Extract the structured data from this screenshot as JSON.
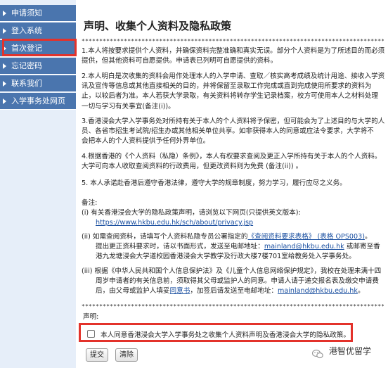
{
  "sidebar": {
    "items": [
      {
        "label": "申请须知"
      },
      {
        "label": "登入系统"
      },
      {
        "label": "首次登记"
      },
      {
        "label": "忘记密码"
      },
      {
        "label": "联系我们"
      },
      {
        "label": "入学事务处网页"
      }
    ],
    "selected": "首次登记"
  },
  "main": {
    "title": "声明、收集个人资料及隐私政策",
    "stars": "**********************************************************************************************",
    "paragraphs": {
      "p1": [
        "1.本人将按要求提供个人资料，并确保资料完整准确和真实无误。部分个人资料是为了所述目的而必须",
        "提供，但其他资料可自愿提供。申请表已列明可自愿提供的资料。"
      ],
      "p2": [
        "2.本人明白是次收集的资料会用作处理本人的入学申请、查取／核实高考成绩及统计用途、接收入学资",
        "讯及宣传等信息或其他直接相关的目的，并将保留至录取工作完成或直到完成使用所要求的资料为",
        "止，以较后者为准。本人若获大学录取，有关资料将转存学生记录档案，校方可使用本人之材料处理",
        "一切与学习有关事宜(备注(i))。"
      ],
      "p3": [
        "3.香港浸会大学入学事务处对所持有关于本人的个人资料将予保密，但可能会为了上述目的与大学的人",
        "员、各省市招生考试院/招生办或其他相关单位共享。如非获得本人的同意或应法令要求，大学将不",
        "会把本人的个人资料提供予任何外界单位。"
      ],
      "p4": [
        "4.根据香港的《个人资料（私隐）条例》，本人有权要求查阅及更正入学所持有关于本人的个人资料。",
        "大学可向本人收取查阅资料的行政费用，但更改资料则为免费 (备注(ii)) 。"
      ],
      "p5": [
        "5. 本人承诺赴香港后遵守香港法律，遵守大学的规章制度，努力学习，履行应尽之义务。"
      ]
    },
    "notes_label": "备注:",
    "note1": {
      "text": "(i)   有关香港浸会大学的隐私政策声明，请浏览以下网页(只提供英文版本):",
      "link": "https://www.hkbu.edu.hk/sch/about/privacy.jsp"
    },
    "note2": {
      "line1_a": "(ii)  如需查阅资料，请填写个人资料私隐专员公署指定的",
      "line1_link": "《查阅资料要求表格》 (表格 OPS003)",
      "line1_b": "。",
      "line2_a": "提出更正资料要求时，请以书面形式，发送至电邮地址：",
      "line2_link": "mainland@hkbu.edu.hk",
      "line2_b": " 或邮寄至香",
      "line3": "港九龙塘浸会大学道校园香港浸会大学教学及行政大楼7楼701室给教务处入学事务处。"
    },
    "note3": {
      "line1": "(iii) 根据《中华人民共和国个人信息保护法》及《儿童个人信息网络保护规定》，我校在处理未满十四",
      "line2": "周岁申请者的有关信息前，须取得其父母或监护人的同意。申请人请于递交报名表及缴交申请费",
      "line3_a": "后，由父母或监护人填妥",
      "line3_link": "同意书",
      "line3_b": "，加签后请发送至电邮地址：",
      "line3_link2": "mainland@hkbu.edu.hk",
      "line3_c": "。"
    },
    "declaration_label": "声明:",
    "declaration_text": "本人同意香港浸会大学入学事务处之收集个人资料声明及香港浸会大学的隐私政策。",
    "declaration_checked": false,
    "submit_label": "提交",
    "clear_label": "清除"
  },
  "watermark": {
    "text": "港智优留学"
  },
  "colors": {
    "nav_bg": "#4a75ae",
    "sidebar_bg": "#e6eef9",
    "highlight": "#e3322b",
    "link": "#1a4fa0"
  }
}
